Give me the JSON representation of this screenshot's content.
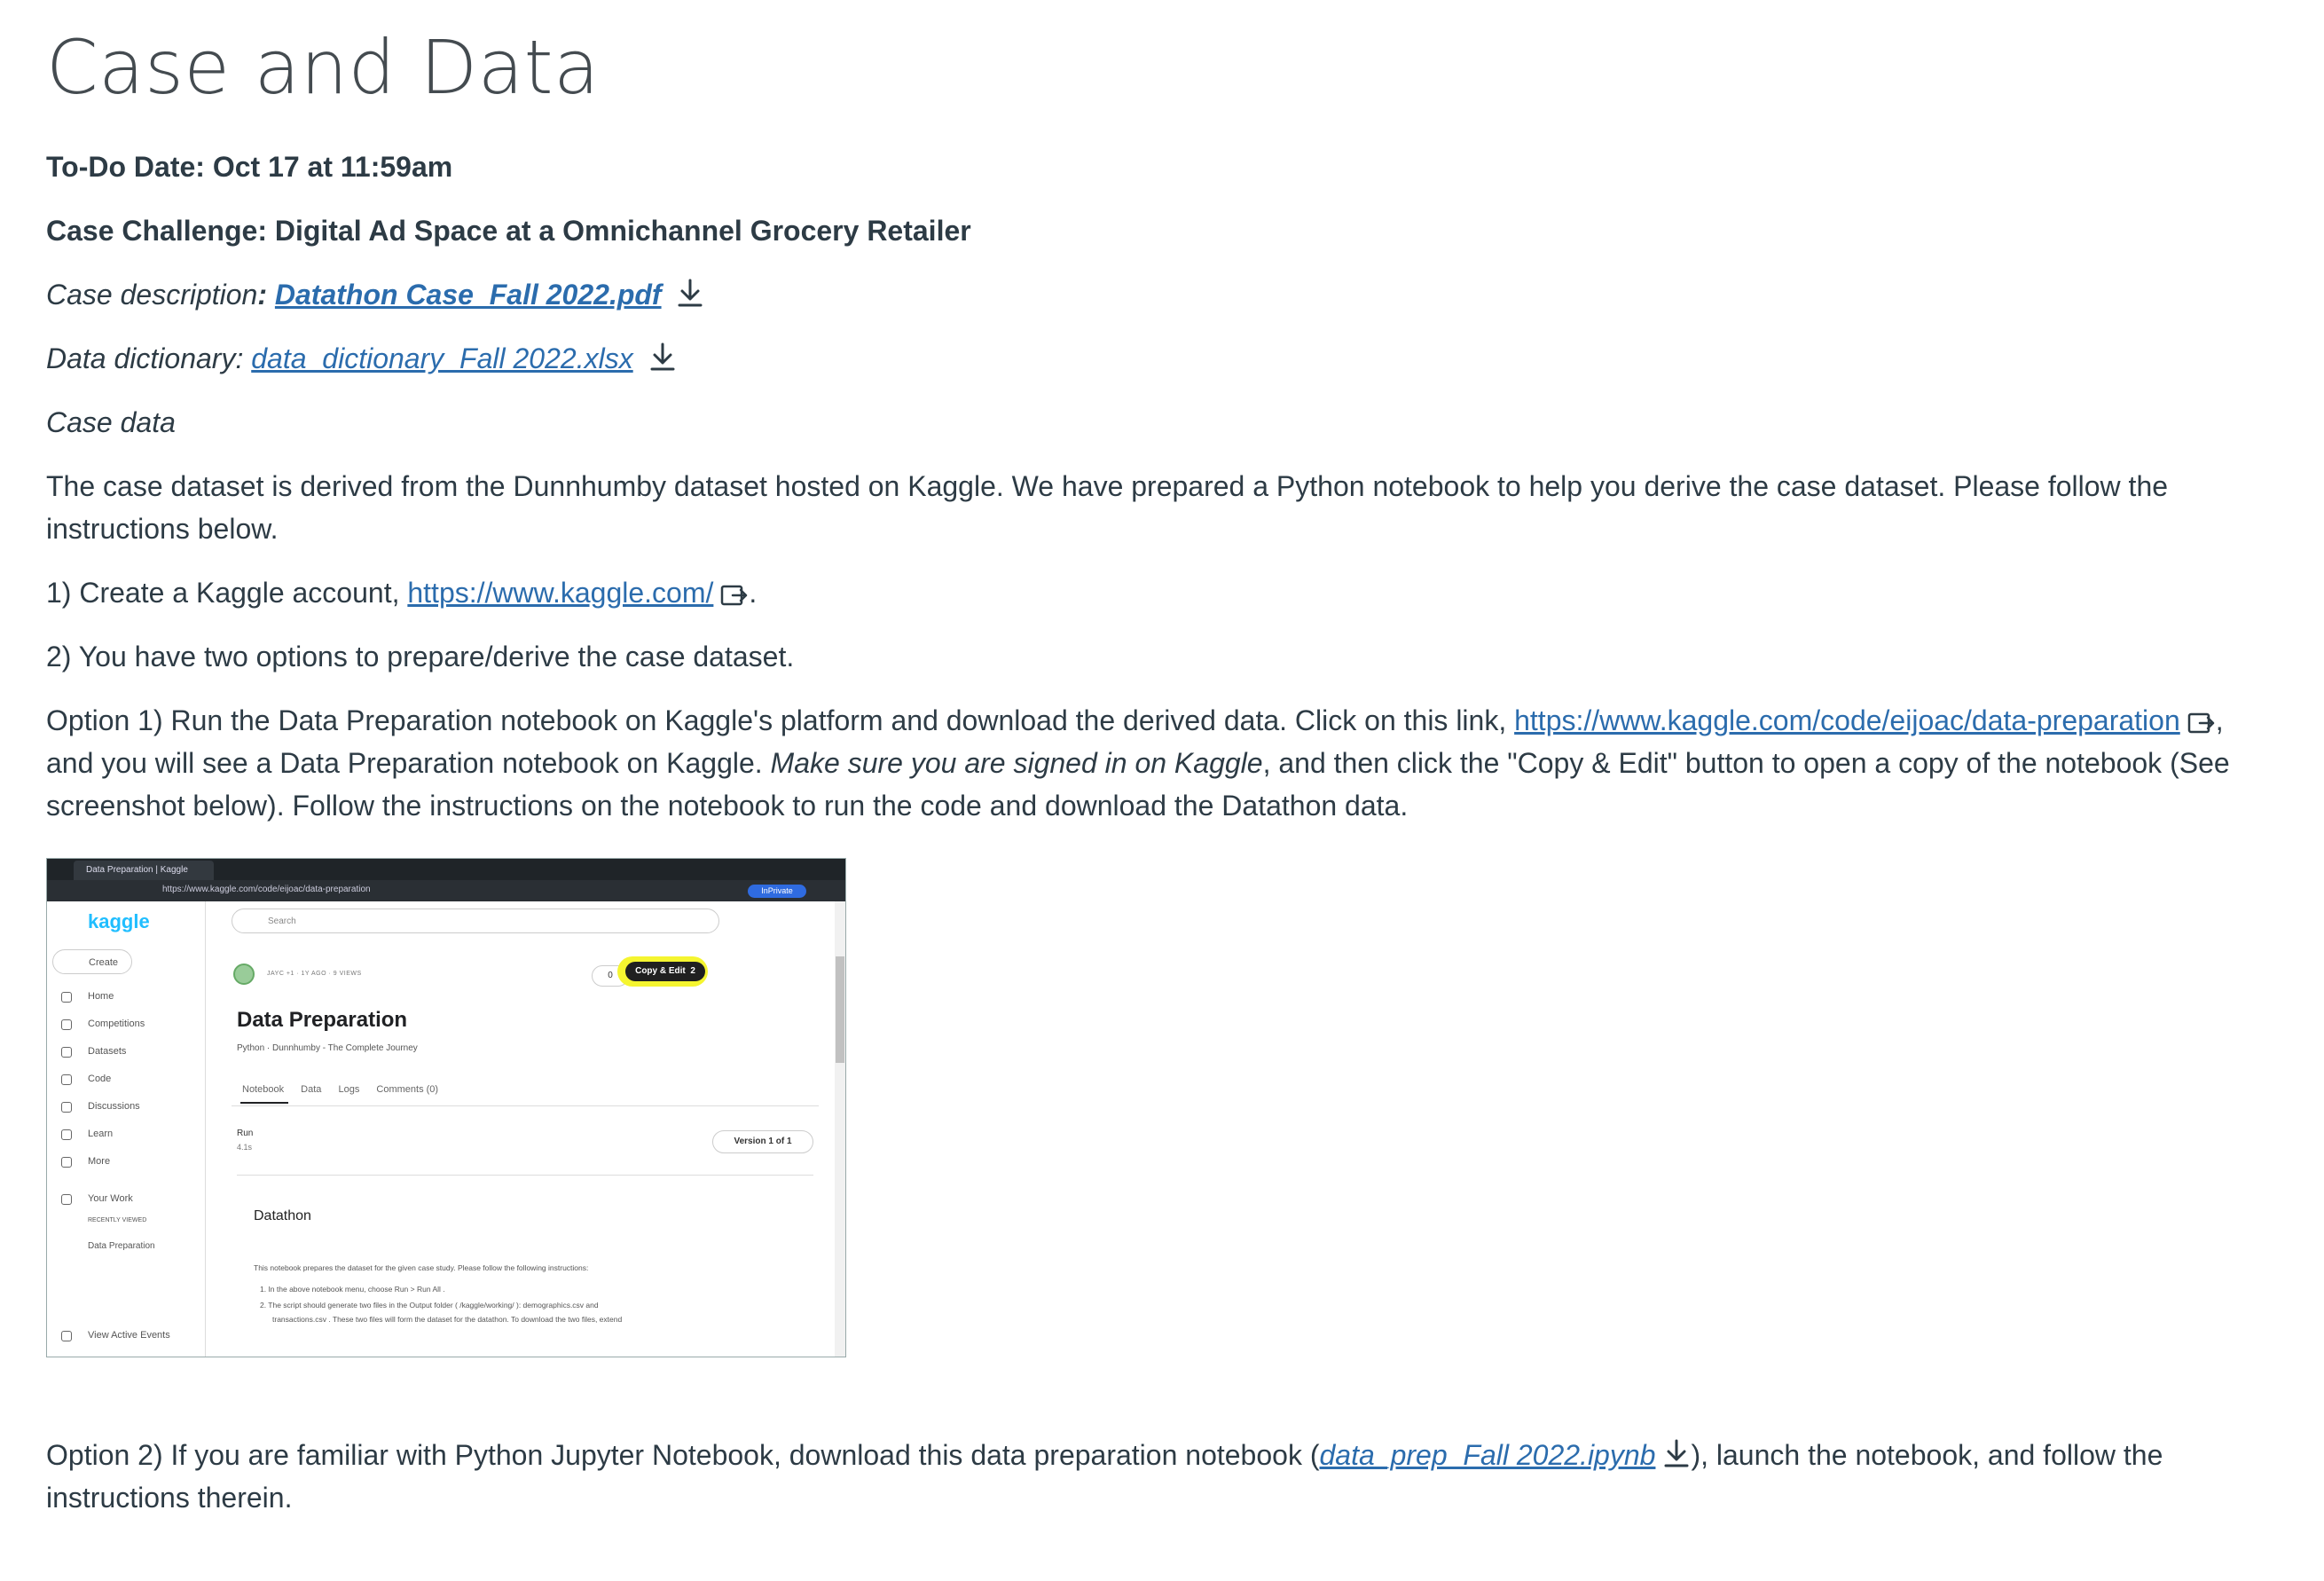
{
  "page": {
    "title": "Case and Data",
    "todo": "To-Do Date: Oct 17 at 11:59am",
    "case_challenge": "Case Challenge: Digital Ad Space at a Omnichannel Grocery Retailer",
    "case_description_label": "Case description",
    "case_description_colon": ":",
    "case_description_file": "Datathon Case_Fall 2022.pdf",
    "data_dictionary_label": "Data dictionary:",
    "data_dictionary_file": "data_dictionary_Fall 2022.xlsx",
    "case_data_label": "Case data",
    "intro": "The case dataset is derived from the Dunnhumby dataset hosted on Kaggle. We have prepared a Python notebook to help you derive the case dataset. Please follow the instructions below.",
    "step1_prefix": "1) Create a Kaggle account, ",
    "step1_link": "https://www.kaggle.com/",
    "step1_suffix": ".",
    "step2": "2) You have two options to prepare/derive the case dataset.",
    "option1_prefix": "Option 1) Run the Data Preparation notebook on Kaggle's platform and download the derived data. Click on this link, ",
    "option1_link": "https://www.kaggle.com/code/eijoac/data-preparation",
    "option1_mid": ", and you will see a Data Preparation notebook on Kaggle. ",
    "option1_italic": "Make sure you are signed in on Kaggle",
    "option1_suffix": ", and then click the \"Copy & Edit\" button to open a copy of the notebook (See screenshot below). Follow the instructions on the notebook to run the code and download the Datathon data.",
    "option2_prefix": "Option 2) If you are familiar with Python Jupyter Notebook, download this data preparation notebook (",
    "option2_link": "data_prep_Fall 2022.ipynb",
    "option2_suffix": "), launch the notebook, and follow the instructions therein."
  },
  "screenshot": {
    "tab_title": "Data Preparation | Kaggle",
    "url": "https://www.kaggle.com/code/eijoac/data-preparation",
    "inprivate": "InPrivate",
    "logo": "kaggle",
    "create": "Create",
    "nav": [
      "Home",
      "Competitions",
      "Datasets",
      "Code",
      "Discussions",
      "Learn",
      "More"
    ],
    "your_work": "Your Work",
    "recently_viewed": "RECENTLY VIEWED",
    "recent_item": "Data Preparation",
    "view_active_events": "View Active Events",
    "search_placeholder": "Search",
    "meta": "JAYC +1 · 1Y AGO · 9 VIEWS",
    "vote_count": "0",
    "copy_edit": "Copy & Edit",
    "copy_edit_count": "2",
    "notebook_title": "Data Preparation",
    "notebook_sub": "Python · Dunnhumby - The Complete Journey",
    "tabs": [
      "Notebook",
      "Data",
      "Logs",
      "Comments (0)"
    ],
    "run_label": "Run",
    "run_value": "4.1s",
    "version": "Version 1 of 1",
    "section_title": "Datathon",
    "para": "This notebook prepares the dataset for the given case study. Please follow the following instructions:",
    "li1": "1. In the above notebook menu, choose  Run > Run All .",
    "li2": "2. The script should generate two files in the Output folder ( /kaggle/working/ ): demographics.csv  and",
    "li3": "transactions.csv . These two files will form the dataset for the datathon. To download the two files, extend"
  },
  "colors": {
    "link": "#2b6cad",
    "text": "#2d3b45",
    "title": "#444b50",
    "kaggle_blue": "#20beff",
    "highlight": "#f5f530"
  },
  "icons": {
    "download": "download-icon",
    "external": "external-link-icon"
  }
}
